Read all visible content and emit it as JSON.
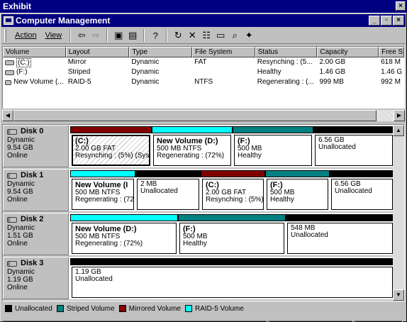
{
  "exhibit": {
    "title": "Exhibit",
    "close": "×"
  },
  "window": {
    "title": "Computer Management",
    "ctrl_min": "_",
    "ctrl_max": "▫",
    "ctrl_close": "×"
  },
  "menu": {
    "action": "Action",
    "view": "View"
  },
  "toolbar_icons": [
    "back-arrow-icon",
    "forward-arrow-icon",
    "up-folder-icon",
    "show-tree-icon",
    "help-icon",
    "refresh-icon",
    "delete-icon",
    "properties-icon",
    "open-icon",
    "search-icon",
    "wizard-icon"
  ],
  "columns": [
    "Volume",
    "Layout",
    "Type",
    "File System",
    "Status",
    "Capacity",
    "Free S"
  ],
  "volumes": [
    {
      "volume": "(C:)",
      "layout": "Mirror",
      "type": "Dynamic",
      "fs": "FAT",
      "status": "Resynching : (5...",
      "capacity": "2.00 GB",
      "free": "618 M"
    },
    {
      "volume": "(F:)",
      "layout": "Striped",
      "type": "Dynamic",
      "fs": "",
      "status": "Healthy",
      "capacity": "1.46 GB",
      "free": "1.46 G"
    },
    {
      "volume": "New Volume (...",
      "layout": "RAID-5",
      "type": "Dynamic",
      "fs": "NTFS",
      "status": "Regenerating : (...",
      "capacity": "999 MB",
      "free": "992 M"
    }
  ],
  "colors": {
    "unallocated": "#000000",
    "striped": "#008080",
    "mirrored": "#800000",
    "raid5": "#00ffff"
  },
  "disks": [
    {
      "name": "Disk 0",
      "type": "Dynamic",
      "size": "9.54 GB",
      "state": "Online",
      "partitions": [
        {
          "name": "(C:)",
          "line1": "2.00 GB FAT",
          "line2": "Resynching : (5%) (Syst"
        },
        {
          "name": "New Volume  (D:)",
          "line1": "500 MB NTFS",
          "line2": "Regenerating : (72%)"
        },
        {
          "name": "(F:)",
          "line1": "500 MB",
          "line2": "Healthy"
        },
        {
          "name": "",
          "line1": "6.56 GB",
          "line2": "Unallocated"
        }
      ]
    },
    {
      "name": "Disk 1",
      "type": "Dynamic",
      "size": "9.54 GB",
      "state": "Online",
      "partitions": [
        {
          "name": "New Volume  (I",
          "line1": "500 MB NTFS",
          "line2": "Regenerating : (72"
        },
        {
          "name": "",
          "line1": "2 MB",
          "line2": "Unallocated"
        },
        {
          "name": "(C:)",
          "line1": "2.00 GB FAT",
          "line2": "Resynching : (5%)"
        },
        {
          "name": "(F:)",
          "line1": "500 MB",
          "line2": "Healthy"
        },
        {
          "name": "",
          "line1": "6.56 GB",
          "line2": "Unallocated"
        }
      ]
    },
    {
      "name": "Disk 2",
      "type": "Dynamic",
      "size": "1.51 GB",
      "state": "Online",
      "partitions": [
        {
          "name": "New Volume  (D:)",
          "line1": "500 MB NTFS",
          "line2": "Regenerating : (72%)"
        },
        {
          "name": "(F:)",
          "line1": "500 MB",
          "line2": "Healthy"
        },
        {
          "name": "",
          "line1": "548 MB",
          "line2": "Unallocated"
        }
      ]
    },
    {
      "name": "Disk 3",
      "type": "Dynamic",
      "size": "1.19 GB",
      "state": "Online",
      "partitions": [
        {
          "name": "",
          "line1": "1.19 GB",
          "line2": "Unallocated"
        }
      ]
    }
  ],
  "legend": [
    {
      "label": "Unallocated"
    },
    {
      "label": "Striped Volume"
    },
    {
      "label": "Mirrored Volume"
    },
    {
      "label": "RAID-5 Volume"
    }
  ]
}
